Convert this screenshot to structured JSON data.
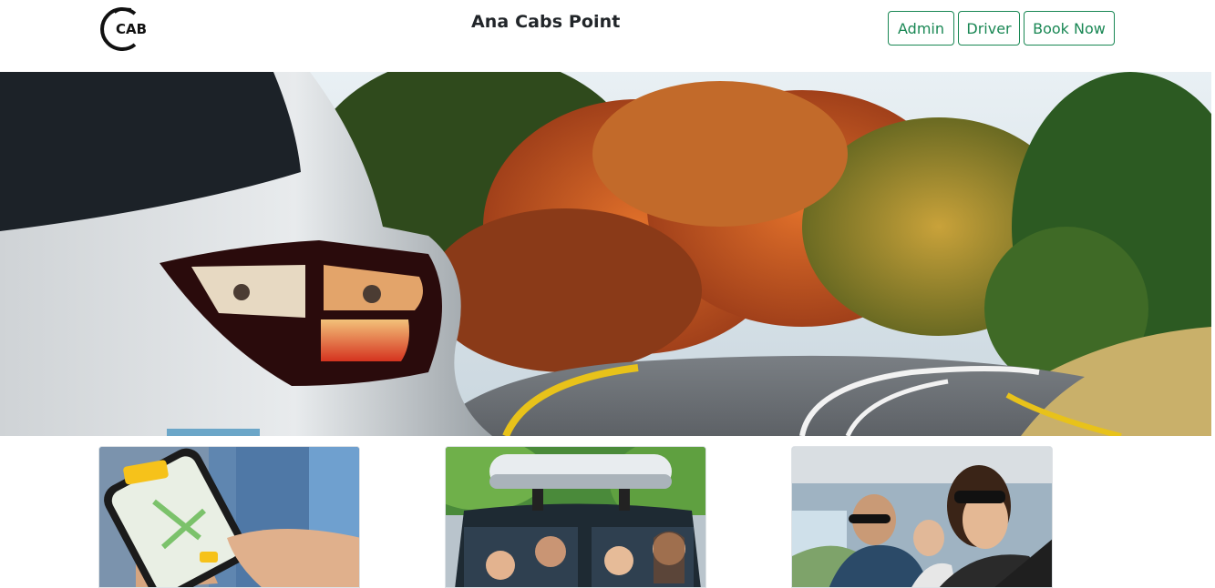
{
  "navbar": {
    "logo_icon": "cab-logo",
    "logo_text": "CAB",
    "title": "Ana Cabs Point",
    "buttons": {
      "admin": "Admin",
      "driver": "Driver",
      "book_now": "Book Now"
    },
    "accent_color": "#198754"
  },
  "hero": {
    "image": "silver-car-taillight-autumn-road"
  },
  "cards": [
    {
      "image": "hand-tapping-call-taxi-app-on-phone"
    },
    {
      "image": "family-in-car-with-roof-box"
    },
    {
      "image": "smiling-couple-driving-with-child"
    }
  ]
}
